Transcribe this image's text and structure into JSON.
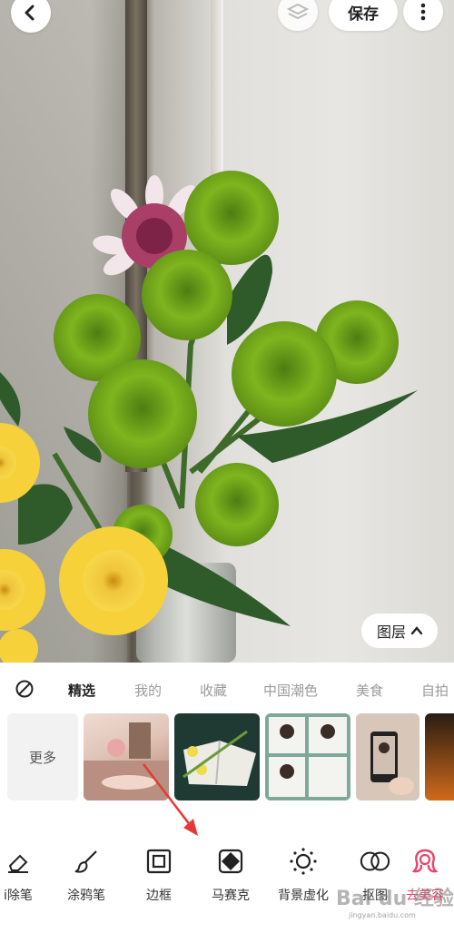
{
  "topbar": {
    "back_icon": "chevron-left-icon",
    "layers_icon": "layers-icon",
    "save_label": "保存",
    "more_icon": "more-vertical-icon"
  },
  "canvas": {
    "layer_button_label": "图层",
    "layer_button_icon": "chevron-up-icon"
  },
  "tabs": {
    "none_icon": "no-sticker-icon",
    "items": [
      {
        "label": "精选"
      },
      {
        "label": "我的"
      },
      {
        "label": "收藏"
      },
      {
        "label": "中国潮色"
      },
      {
        "label": "美食"
      },
      {
        "label": "自拍"
      }
    ],
    "active_index": 0
  },
  "thumbs": {
    "more_label": "更多"
  },
  "toolbar": {
    "items": [
      {
        "label": "i除笔",
        "icon": "eraser-icon"
      },
      {
        "label": "涂鸦笔",
        "icon": "brush-icon"
      },
      {
        "label": "边框",
        "icon": "frame-icon"
      },
      {
        "label": "马赛克",
        "icon": "mosaic-icon"
      },
      {
        "label": "背景虚化",
        "icon": "blur-icon"
      },
      {
        "label": "抠图",
        "icon": "cutout-icon"
      },
      {
        "label": "去美容",
        "icon": "beauty-icon"
      }
    ],
    "active_index": 6
  },
  "watermark": {
    "text": "Bai du 经验",
    "sub": "jingyan.baidu.com"
  },
  "colors": {
    "accent": "#e8456b",
    "arrow": "#e53935"
  }
}
